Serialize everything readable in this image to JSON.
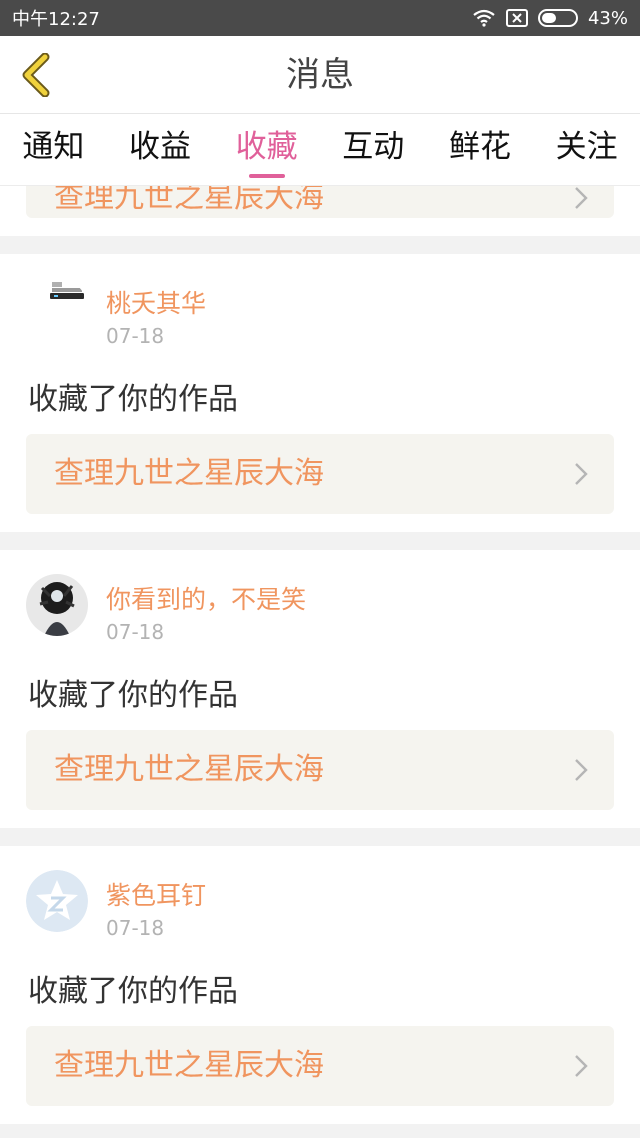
{
  "statusbar": {
    "time": "中午12:27",
    "battery": "43%",
    "battery_level": 0.43
  },
  "header": {
    "title": "消息"
  },
  "tabs": [
    {
      "label": "通知",
      "active": false
    },
    {
      "label": "收益",
      "active": false
    },
    {
      "label": "收藏",
      "active": true
    },
    {
      "label": "互动",
      "active": false
    },
    {
      "label": "鲜花",
      "active": false
    },
    {
      "label": "关注",
      "active": false
    }
  ],
  "partial": {
    "work_title": "查理九世之星辰大海"
  },
  "items": [
    {
      "username": "桃夭其华",
      "date": "07-18",
      "action": "收藏了你的作品",
      "work_title": "查理九世之星辰大海",
      "avatar": "router-image"
    },
    {
      "username": "你看到的，不是笑",
      "date": "07-18",
      "action": "收藏了你的作品",
      "work_title": "查理九世之星辰大海",
      "avatar": "dark-photo"
    },
    {
      "username": "紫色耳钉",
      "date": "07-18",
      "action": "收藏了你的作品",
      "work_title": "查理九世之星辰大海",
      "avatar": "qq-default"
    }
  ],
  "colors": {
    "accent": "#e0609a",
    "orange": "#f0955f",
    "back_arrow": "#f0d23c"
  }
}
